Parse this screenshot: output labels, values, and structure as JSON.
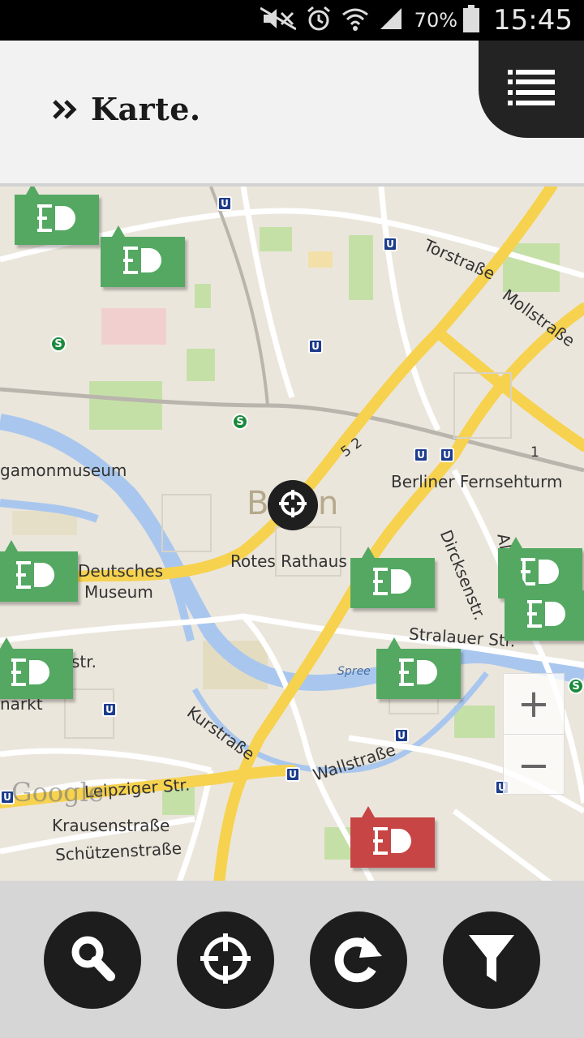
{
  "status_bar": {
    "battery_percent": "70%",
    "time": "15:45",
    "icons": [
      "mute-icon",
      "alarm-icon",
      "wifi-icon",
      "signal-icon",
      "battery-icon"
    ]
  },
  "header": {
    "title": "Karte.",
    "menu_icon": "list-icon"
  },
  "map": {
    "labels": [
      {
        "text": "Torstraße"
      },
      {
        "text": "Mollstraße"
      },
      {
        "text": "gamonmuseum"
      },
      {
        "text": "Berliner Fernsehturm"
      },
      {
        "text": "Rotes Rathaus"
      },
      {
        "text": "Deutsches"
      },
      {
        "text": "Museum"
      },
      {
        "text": "Dircksenstr."
      },
      {
        "text": "Stralauer Str."
      },
      {
        "text": "Spree"
      },
      {
        "text": "str."
      },
      {
        "text": "narkt"
      },
      {
        "text": "Kurstraße"
      },
      {
        "text": "Wallstraße"
      },
      {
        "text": "Leipziger Str."
      },
      {
        "text": "Krausenstraße"
      },
      {
        "text": "Schützenstraße"
      },
      {
        "text": "5 2"
      },
      {
        "text": "1"
      },
      {
        "text": "Alex"
      },
      {
        "text": "B"
      },
      {
        "text": "n"
      }
    ],
    "google_logo": "Google",
    "zoom_in": "+",
    "zoom_out": "−",
    "colors": {
      "marker_available": "#54a862",
      "marker_occupied": "#c74544",
      "road_major": "#f6d24f",
      "water": "#a9c7ee",
      "park": "#c5e0a7"
    }
  },
  "toolbar": {
    "buttons": [
      "search-icon",
      "crosshair-icon",
      "refresh-icon",
      "filter-icon"
    ]
  }
}
